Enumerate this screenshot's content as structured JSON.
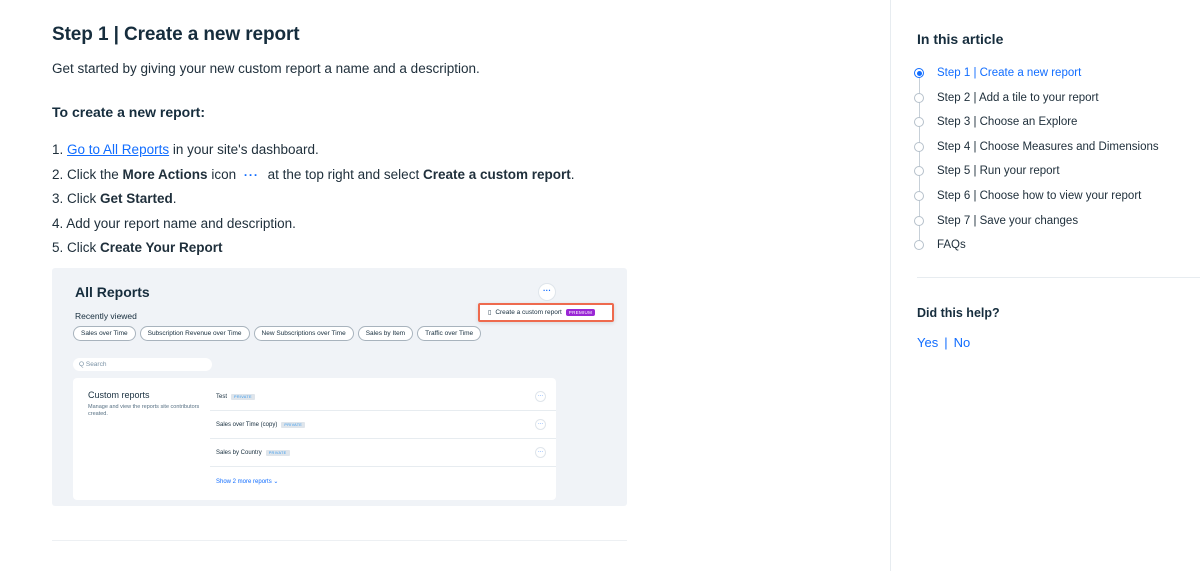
{
  "article": {
    "heading": "Step 1 | Create a new report",
    "intro": "Get started by giving your new custom report a name and a description.",
    "subheading": "To create a new report:",
    "steps": [
      {
        "num": "1.",
        "link": "Go to All Reports",
        "rest": " in your site's dashboard."
      },
      {
        "num": "2.",
        "pre": " Click the ",
        "bold1": "More Actions",
        "mid": " icon ",
        "icon": "···",
        "post": " at the top right and select ",
        "bold2": "Create a custom report",
        "end": "."
      },
      {
        "num": "3.",
        "pre": " Click ",
        "bold": "Get Started",
        "end": "."
      },
      {
        "num": "4.",
        "text": " Add your report name and description."
      },
      {
        "num": "5.",
        "pre": " Click ",
        "bold": "Create Your Report"
      }
    ]
  },
  "screenshot": {
    "title": "All Reports",
    "more_icon": "···",
    "recently_viewed": "Recently viewed",
    "chips": [
      "Sales over Time",
      "Subscription Revenue over Time",
      "New Subscriptions over Time",
      "Sales by Item",
      "Traffic over Time"
    ],
    "menu_item": "Create a custom report",
    "menu_badge": "PREMIUM",
    "search_placeholder": "Q  Search",
    "card_title": "Custom reports",
    "card_desc": "Manage and view the reports site contributors created.",
    "rows": [
      {
        "name": "Test",
        "badge": "PRIVATE"
      },
      {
        "name": "Sales over Time (copy)",
        "badge": "PRIVATE"
      },
      {
        "name": "Sales by Country",
        "badge": "PRIVATE"
      }
    ],
    "show_more": "Show 2 more reports  ⌄"
  },
  "sidebar": {
    "toc_title": "In this article",
    "toc": [
      "Step 1 | Create a new report",
      "Step 2 | Add a tile to your report",
      "Step 3 | Choose an Explore",
      "Step 4 | Choose Measures and Dimensions",
      "Step 5 | Run your report",
      "Step 6 | Choose how to view your report",
      "Step 7 | Save your changes",
      "FAQs"
    ],
    "active_index": 0,
    "help_title": "Did this help?",
    "yes": "Yes",
    "separator": "|",
    "no": "No"
  },
  "colors": {
    "accent": "#116dff",
    "heading": "#162d3d",
    "highlight_border": "#ee6a4e",
    "premium": "#9a27d5"
  }
}
